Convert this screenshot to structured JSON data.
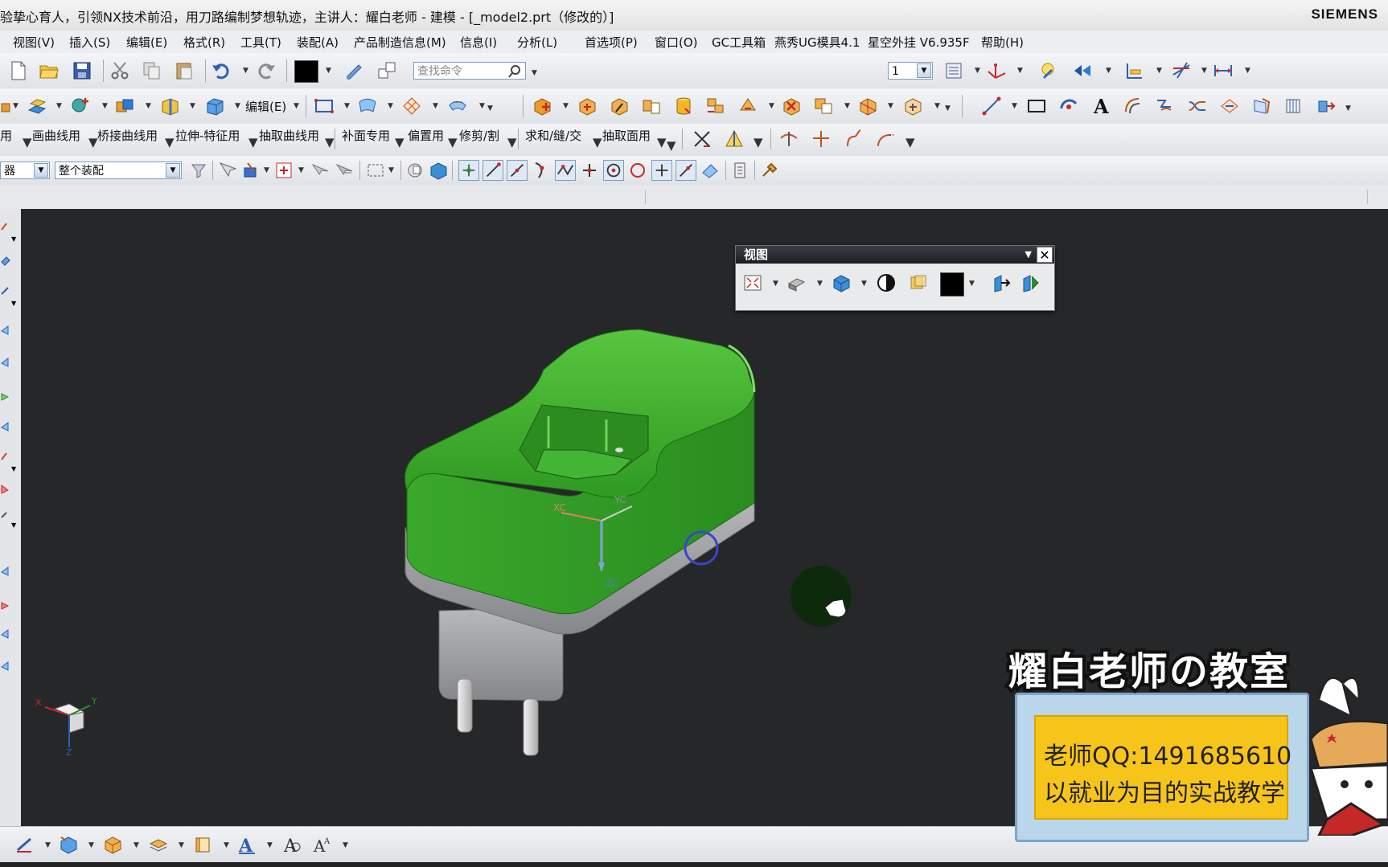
{
  "window": {
    "title": "验挚心育人，引领NX技术前沿，用刀路编制梦想轨迹，主讲人：耀白老师 - 建模 - [_model2.prt（修改的）]",
    "brand": "SIEMENS"
  },
  "menu": [
    "视图(V)",
    "插入(S)",
    "编辑(E)",
    "格式(R)",
    "工具(T)",
    "装配(A)",
    "产品制造信息(M)",
    "信息(I)",
    "分析(L)",
    "首选项(P)",
    "窗口(O)",
    "GC工具箱",
    "燕秀UG模具4.1",
    "星空外挂 V6.935F",
    "帮助(H)"
  ],
  "toolbar1": {
    "search_placeholder": "查找命令",
    "layer_value": "1"
  },
  "toolbar2": {
    "edit_label": "编辑(E)"
  },
  "toolbar3": {
    "groups": [
      "用",
      "画曲线用",
      "桥接曲线用",
      "拉伸-特征用",
      "抽取曲线用",
      "补面专用",
      "偏置用",
      "修剪/割",
      "求和/缝/交",
      "抽取面用"
    ]
  },
  "selection_bar": {
    "filter_value": "器",
    "scope_value": "整个装配"
  },
  "viewport": {
    "axis_labels": {
      "xc": "XC",
      "yc": "YC",
      "zc": "ZC"
    },
    "triad_labels": {
      "x": "X",
      "y": "Y",
      "z": "Z"
    }
  },
  "view_panel": {
    "title": "视图",
    "close": "✕"
  },
  "banner": {
    "title": "耀白老师の教室",
    "qq": "老师QQ:1491685610",
    "slogan": "以就业为目的实战教学"
  },
  "colors": {
    "viewport_bg": "#262728",
    "model_green": "#3fae2e",
    "model_gray": "#9a9c9e",
    "banner_yellow": "#f7c51a"
  }
}
